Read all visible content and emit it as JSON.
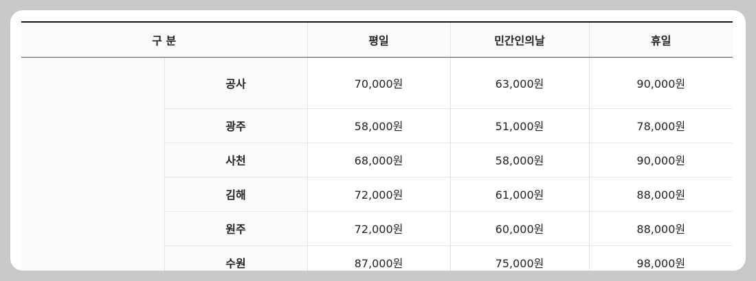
{
  "table": {
    "headers": {
      "category": "구 분",
      "weekday": "평일",
      "civil_defense_day": "민간인의날",
      "holiday": "휴일"
    },
    "rows": [
      {
        "region": "공사",
        "weekday": "70,000원",
        "civil_defense_day": "63,000원",
        "holiday": "90,000원"
      },
      {
        "region": "광주",
        "weekday": "58,000원",
        "civil_defense_day": "51,000원",
        "holiday": "78,000원"
      },
      {
        "region": "사천",
        "weekday": "68,000원",
        "civil_defense_day": "58,000원",
        "holiday": "90,000원"
      },
      {
        "region": "김해",
        "weekday": "72,000원",
        "civil_defense_day": "61,000원",
        "holiday": "88,000원"
      },
      {
        "region": "원주",
        "weekday": "72,000원",
        "civil_defense_day": "60,000원",
        "holiday": "88,000원"
      },
      {
        "region": "수원",
        "weekday": "87,000원",
        "civil_defense_day": "75,000원",
        "holiday": "98,000원"
      }
    ]
  }
}
